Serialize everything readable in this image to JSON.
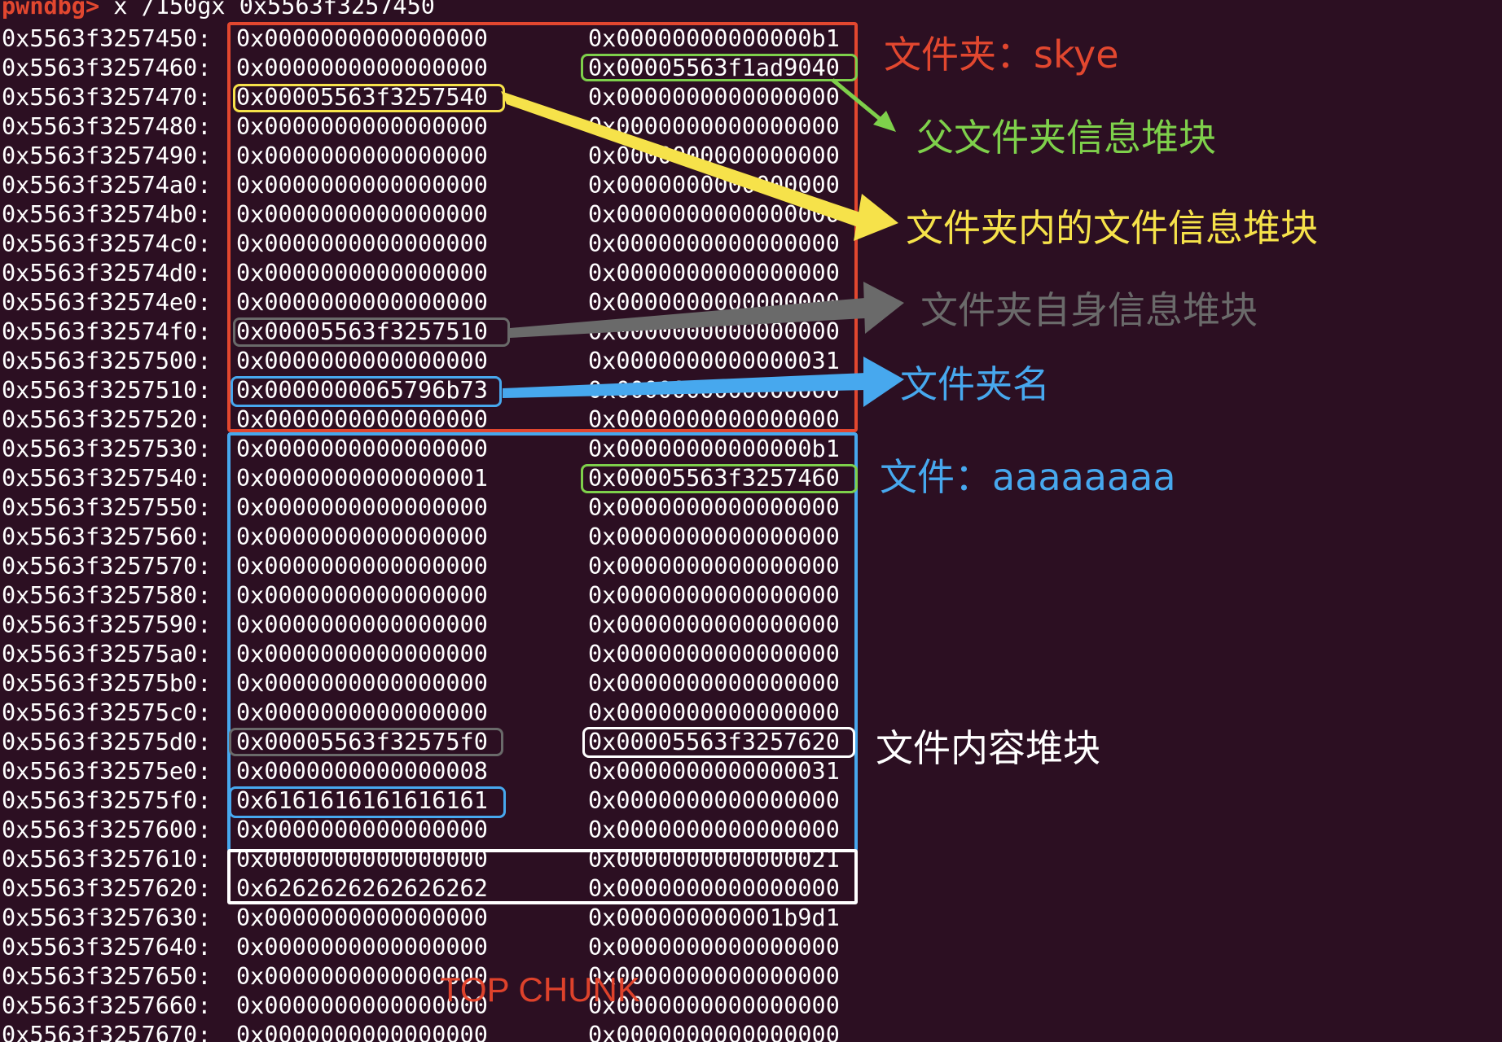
{
  "terminal": {
    "prompt": "pwndbg>",
    "command": " x /150gx 0x5563f3257450",
    "rows": [
      {
        "addr": "0x5563f3257450:",
        "w1": "0x0000000000000000",
        "w2": "0x00000000000000b1"
      },
      {
        "addr": "0x5563f3257460:",
        "w1": "0x0000000000000000",
        "w2": "0x00005563f1ad9040"
      },
      {
        "addr": "0x5563f3257470:",
        "w1": "0x00005563f3257540",
        "w2": "0x0000000000000000"
      },
      {
        "addr": "0x5563f3257480:",
        "w1": "0x0000000000000000",
        "w2": "0x0000000000000000"
      },
      {
        "addr": "0x5563f3257490:",
        "w1": "0x0000000000000000",
        "w2": "0x0000000000000000"
      },
      {
        "addr": "0x5563f32574a0:",
        "w1": "0x0000000000000000",
        "w2": "0x0000000000000000"
      },
      {
        "addr": "0x5563f32574b0:",
        "w1": "0x0000000000000000",
        "w2": "0x0000000000000000"
      },
      {
        "addr": "0x5563f32574c0:",
        "w1": "0x0000000000000000",
        "w2": "0x0000000000000000"
      },
      {
        "addr": "0x5563f32574d0:",
        "w1": "0x0000000000000000",
        "w2": "0x0000000000000000"
      },
      {
        "addr": "0x5563f32574e0:",
        "w1": "0x0000000000000000",
        "w2": "0x0000000000000000"
      },
      {
        "addr": "0x5563f32574f0:",
        "w1": "0x00005563f3257510",
        "w2": "0x0000000000000000"
      },
      {
        "addr": "0x5563f3257500:",
        "w1": "0x0000000000000000",
        "w2": "0x0000000000000031"
      },
      {
        "addr": "0x5563f3257510:",
        "w1": "0x0000000065796b73",
        "w2": "0x0000000000000000"
      },
      {
        "addr": "0x5563f3257520:",
        "w1": "0x0000000000000000",
        "w2": "0x0000000000000000"
      },
      {
        "addr": "0x5563f3257530:",
        "w1": "0x0000000000000000",
        "w2": "0x00000000000000b1"
      },
      {
        "addr": "0x5563f3257540:",
        "w1": "0x0000000000000001",
        "w2": "0x00005563f3257460"
      },
      {
        "addr": "0x5563f3257550:",
        "w1": "0x0000000000000000",
        "w2": "0x0000000000000000"
      },
      {
        "addr": "0x5563f3257560:",
        "w1": "0x0000000000000000",
        "w2": "0x0000000000000000"
      },
      {
        "addr": "0x5563f3257570:",
        "w1": "0x0000000000000000",
        "w2": "0x0000000000000000"
      },
      {
        "addr": "0x5563f3257580:",
        "w1": "0x0000000000000000",
        "w2": "0x0000000000000000"
      },
      {
        "addr": "0x5563f3257590:",
        "w1": "0x0000000000000000",
        "w2": "0x0000000000000000"
      },
      {
        "addr": "0x5563f32575a0:",
        "w1": "0x0000000000000000",
        "w2": "0x0000000000000000"
      },
      {
        "addr": "0x5563f32575b0:",
        "w1": "0x0000000000000000",
        "w2": "0x0000000000000000"
      },
      {
        "addr": "0x5563f32575c0:",
        "w1": "0x0000000000000000",
        "w2": "0x0000000000000000"
      },
      {
        "addr": "0x5563f32575d0:",
        "w1": "0x00005563f32575f0",
        "w2": "0x00005563f3257620"
      },
      {
        "addr": "0x5563f32575e0:",
        "w1": "0x0000000000000008",
        "w2": "0x0000000000000031"
      },
      {
        "addr": "0x5563f32575f0:",
        "w1": "0x6161616161616161",
        "w2": "0x0000000000000000"
      },
      {
        "addr": "0x5563f3257600:",
        "w1": "0x0000000000000000",
        "w2": "0x0000000000000000"
      },
      {
        "addr": "0x5563f3257610:",
        "w1": "0x0000000000000000",
        "w2": "0x0000000000000021"
      },
      {
        "addr": "0x5563f3257620:",
        "w1": "0x6262626262626262",
        "w2": "0x0000000000000000"
      },
      {
        "addr": "0x5563f3257630:",
        "w1": "0x0000000000000000",
        "w2": "0x000000000001b9d1"
      },
      {
        "addr": "0x5563f3257640:",
        "w1": "0x0000000000000000",
        "w2": "0x0000000000000000"
      },
      {
        "addr": "0x5563f3257650:",
        "w1": "0x0000000000000000",
        "w2": "0x0000000000000000"
      },
      {
        "addr": "0x5563f3257660:",
        "w1": "0x0000000000000000",
        "w2": "0x0000000000000000"
      },
      {
        "addr": "0x5563f3257670:",
        "w1": "0x0000000000000000",
        "w2": "0x0000000000000000"
      }
    ]
  },
  "annotations": {
    "folder_label": "文件夹：skye",
    "parent_folder_info": "父文件夹信息堆块",
    "file_info_in_folder": "文件夹内的文件信息堆块",
    "folder_self_info": "文件夹自身信息堆块",
    "folder_name": "文件夹名",
    "file_label": "文件：aaaaaaaa",
    "file_content_chunk": "文件内容堆块",
    "top_chunk": "TOP CHUNK"
  },
  "colors": {
    "background": "#2c0f22",
    "red": "#e2472f",
    "green": "#7ed04b",
    "yellow": "#f6e24a",
    "gray": "#6a6a6a",
    "blue": "#47a8ee",
    "white": "#ffffff"
  }
}
